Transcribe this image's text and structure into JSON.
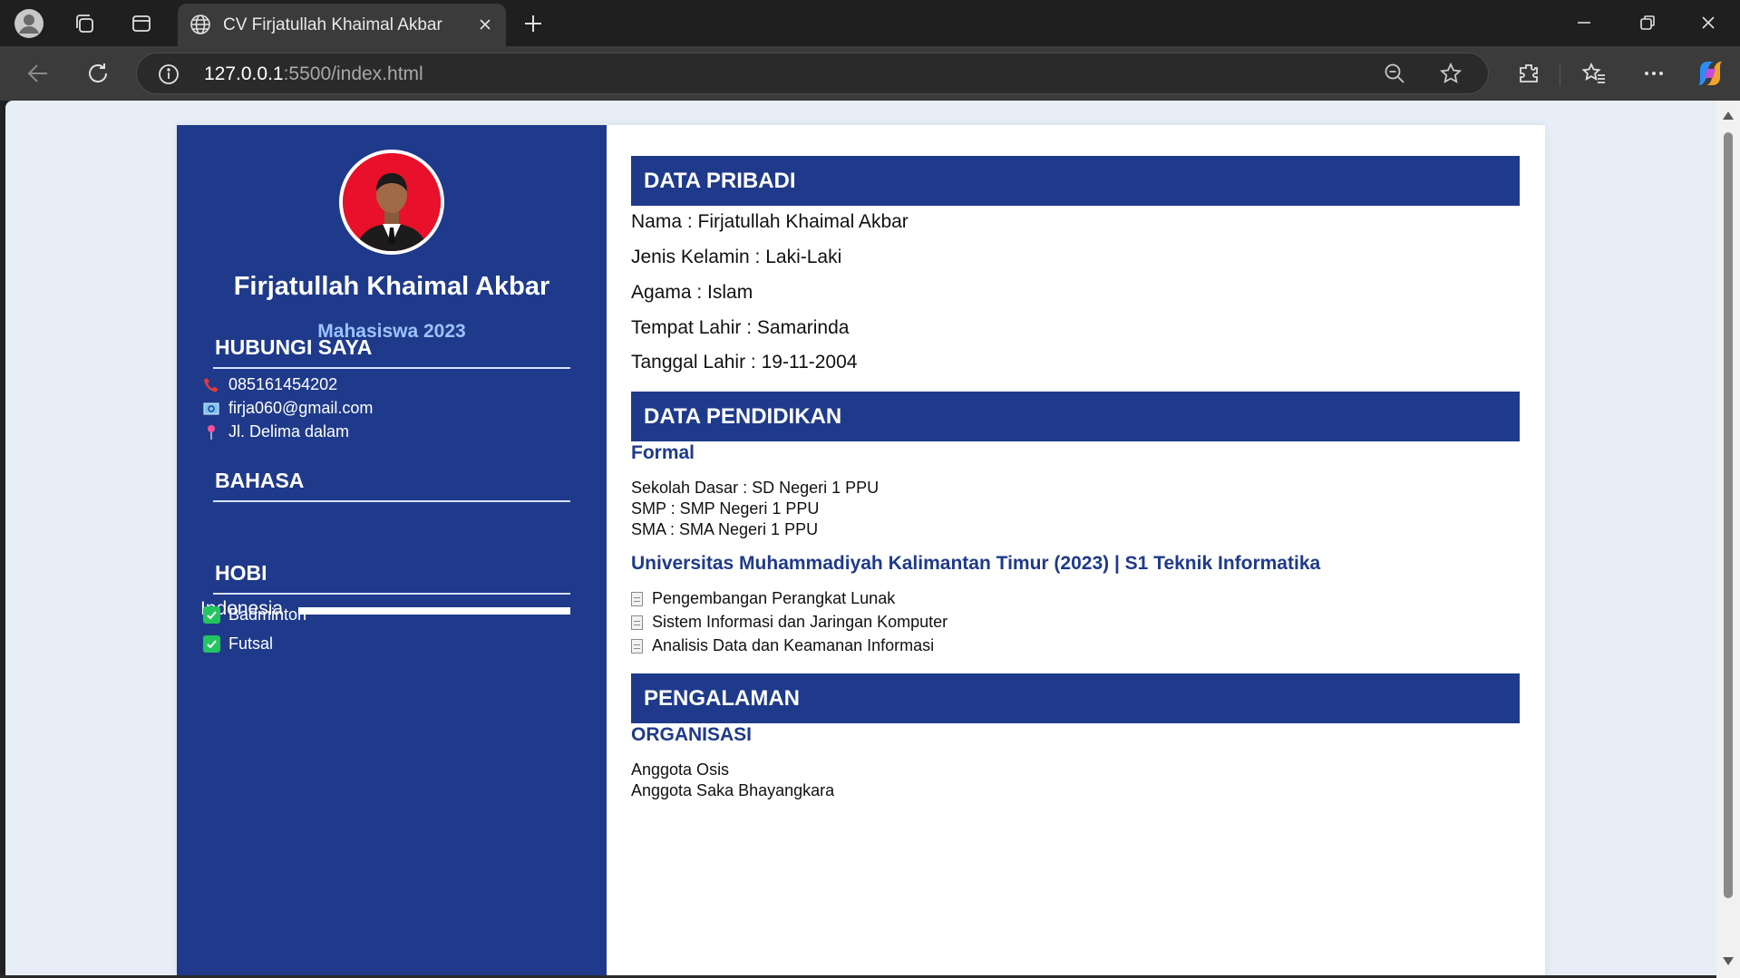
{
  "browser": {
    "tab_title": "CV Firjatullah Khaimal Akbar",
    "url_host": "127.0.0.1",
    "url_path": ":5500/index.html"
  },
  "profile": {
    "name": "Firjatullah Khaimal Akbar",
    "role": "Mahasiswa 2023"
  },
  "contact": {
    "heading": "HUBUNGI SAYA",
    "phone": "085161454202",
    "email": "firja060@gmail.com",
    "address": "Jl. Delima dalam"
  },
  "language": {
    "heading": "BAHASA",
    "items": [
      {
        "label": "Indonesia",
        "level": 1.0
      }
    ]
  },
  "hobbies": {
    "heading": "HOBI",
    "items": [
      "Badminton",
      "Futsal"
    ]
  },
  "personal": {
    "heading": "DATA PRIBADI",
    "lines": [
      "Nama : Firjatullah Khaimal Akbar",
      "Jenis Kelamin : Laki-Laki",
      "Agama : Islam",
      "Tempat Lahir : Samarinda",
      "Tanggal Lahir : 19-11-2004"
    ]
  },
  "education": {
    "heading": "DATA PENDIDIKAN",
    "formal_title": "Formal",
    "formal": [
      "Sekolah Dasar : SD Negeri 1 PPU",
      "SMP : SMP Negeri 1 PPU",
      "SMA : SMA Negeri 1 PPU"
    ],
    "university_title": "Universitas Muhammadiyah Kalimantan Timur (2023) | S1 Teknik Informatika",
    "courses": [
      "Pengembangan Perangkat Lunak",
      "Sistem Informasi dan Jaringan Komputer",
      "Analisis Data dan Keamanan Informasi"
    ]
  },
  "experience": {
    "heading": "PENGALAMAN",
    "org_title": "ORGANISASI",
    "items": [
      "Anggota Osis",
      "Anggota Saka Bhayangkara"
    ]
  },
  "colors": {
    "primary": "#1f3a8a",
    "accent_light": "#9cc2ff",
    "page_bg": "#e8eef7"
  }
}
